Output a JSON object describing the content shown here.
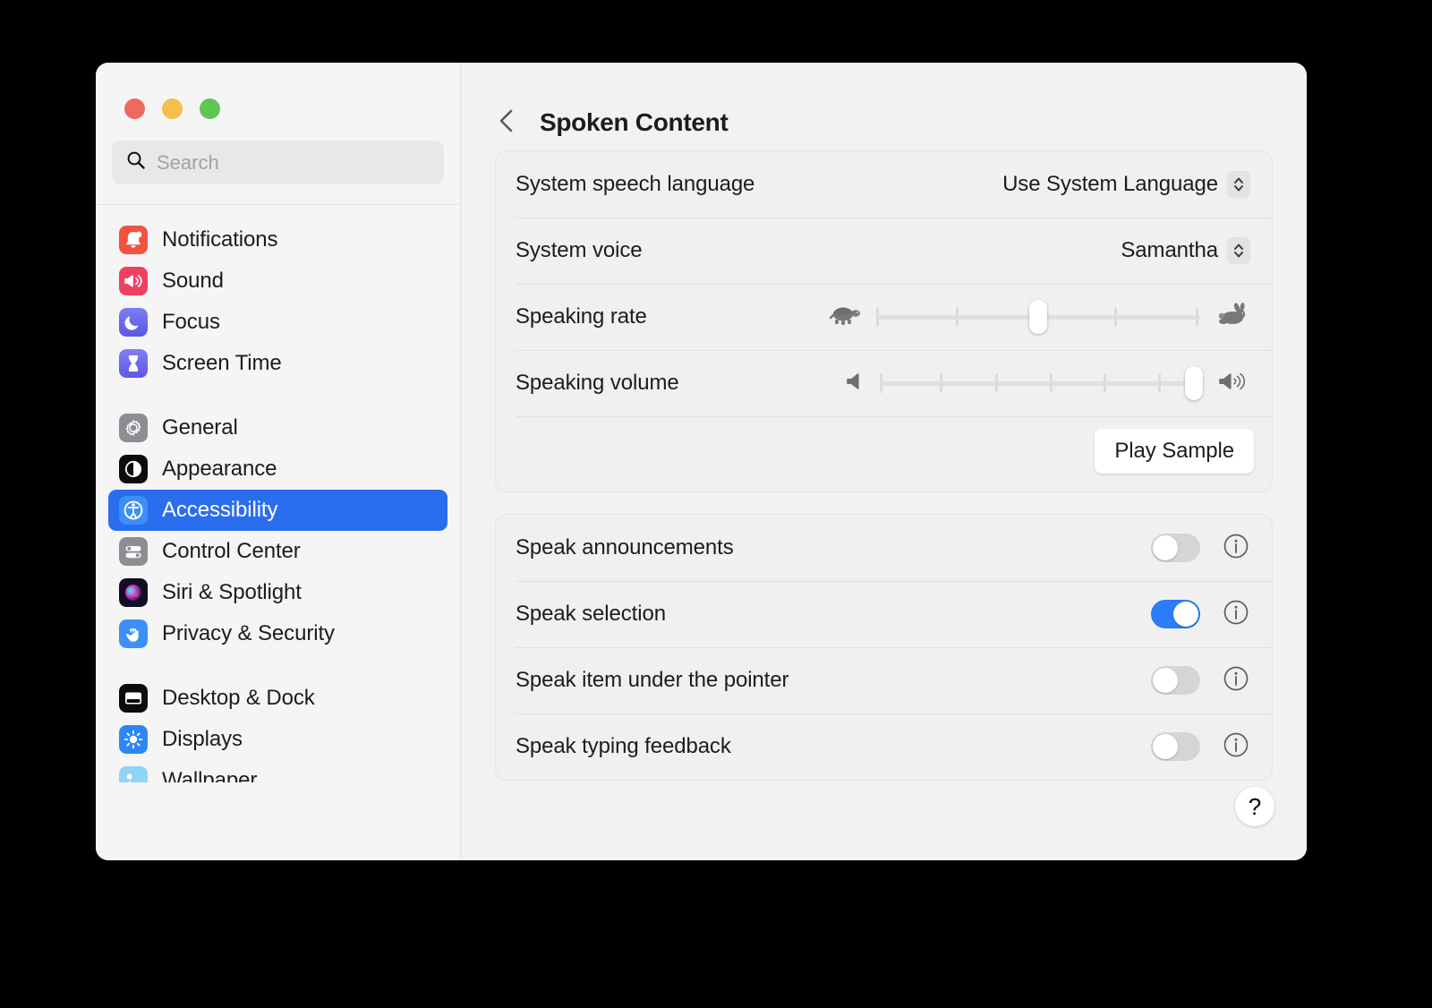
{
  "window": {
    "traffic_lights": [
      {
        "name": "close",
        "color": "#ec6a5f"
      },
      {
        "name": "minimize",
        "color": "#f3bf4f"
      },
      {
        "name": "maximize",
        "color": "#61c554"
      }
    ]
  },
  "sidebar": {
    "search": {
      "placeholder": "Search",
      "value": ""
    },
    "groups": [
      {
        "items": [
          {
            "label": "Notifications",
            "icon": "notifications-icon",
            "selected": false
          },
          {
            "label": "Sound",
            "icon": "sound-icon",
            "selected": false
          },
          {
            "label": "Focus",
            "icon": "focus-icon",
            "selected": false
          },
          {
            "label": "Screen Time",
            "icon": "screen-time-icon",
            "selected": false
          }
        ]
      },
      {
        "items": [
          {
            "label": "General",
            "icon": "general-icon",
            "selected": false
          },
          {
            "label": "Appearance",
            "icon": "appearance-icon",
            "selected": false
          },
          {
            "label": "Accessibility",
            "icon": "accessibility-icon",
            "selected": true
          },
          {
            "label": "Control Center",
            "icon": "control-center-icon",
            "selected": false
          },
          {
            "label": "Siri & Spotlight",
            "icon": "siri-icon",
            "selected": false
          },
          {
            "label": "Privacy & Security",
            "icon": "privacy-icon",
            "selected": false
          }
        ]
      },
      {
        "items": [
          {
            "label": "Desktop & Dock",
            "icon": "desktop-dock-icon",
            "selected": false
          },
          {
            "label": "Displays",
            "icon": "displays-icon",
            "selected": false
          },
          {
            "label": "Wallpaper",
            "icon": "wallpaper-icon",
            "selected": false
          }
        ]
      }
    ]
  },
  "main": {
    "title": "Spoken Content",
    "back_icon": "chevron-left-icon",
    "speech_card": {
      "language": {
        "label": "System speech language",
        "value": "Use System Language"
      },
      "voice": {
        "label": "System voice",
        "value": "Samantha"
      },
      "rate": {
        "label": "Speaking rate",
        "min_icon": "turtle-icon",
        "max_icon": "rabbit-icon",
        "percent": 50,
        "tick_count": 5
      },
      "volume": {
        "label": "Speaking volume",
        "min_icon": "speaker-low-icon",
        "max_icon": "speaker-high-icon",
        "percent": 97,
        "tick_count": 6
      },
      "play_sample_label": "Play Sample"
    },
    "toggles_card": {
      "rows": [
        {
          "label": "Speak announcements",
          "on": false,
          "info_icon": "info-icon"
        },
        {
          "label": "Speak selection",
          "on": true,
          "info_icon": "info-icon"
        },
        {
          "label": "Speak item under the pointer",
          "on": false,
          "info_icon": "info-icon"
        },
        {
          "label": "Speak typing feedback",
          "on": false,
          "info_icon": "info-icon"
        }
      ]
    },
    "help_label": "?"
  },
  "colors": {
    "accent": "#2b6def",
    "toggle_on": "#2b7cf6",
    "window_bg": "#f2f2f2",
    "sidebar_bg": "#f5f5f5",
    "card_bg": "#f0f0f0"
  }
}
